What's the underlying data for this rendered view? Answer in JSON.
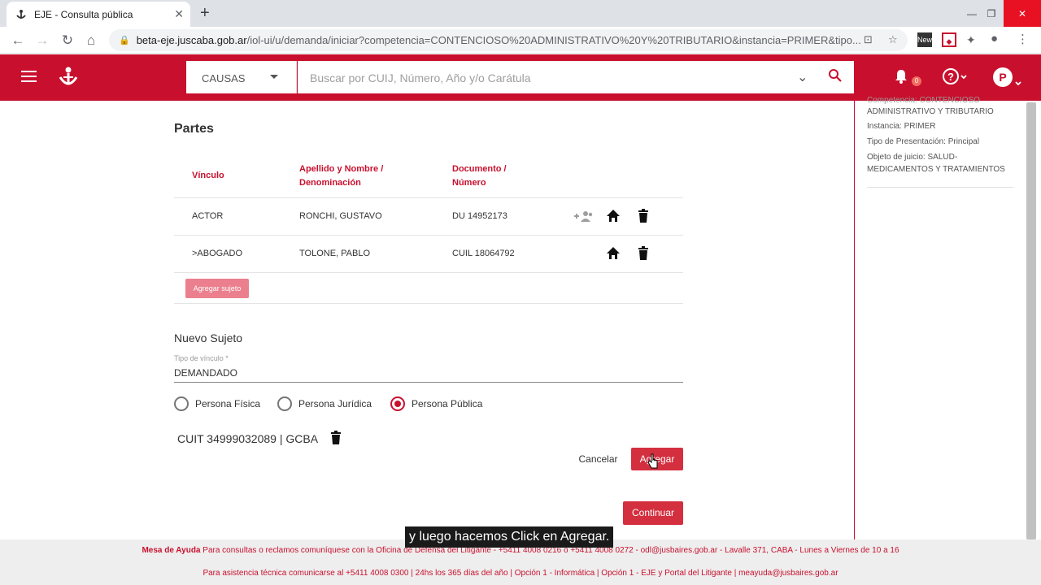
{
  "browser": {
    "tab_title": "EJE - Consulta pública",
    "url_host": "beta-eje.juscaba.gob.ar",
    "url_path": "/iol-ui/u/demanda/iniciar?competencia=CONTENCIOSO%20ADMINISTRATIVO%20Y%20TRIBUTARIO&instancia=PRIMER&tipo..."
  },
  "header": {
    "search_category": "CAUSAS",
    "search_placeholder": "Buscar por CUIJ, Número, Año y/o Carátula",
    "notification_count": "0",
    "avatar_initial": "P"
  },
  "partes": {
    "title": "Partes",
    "columns": {
      "vinculo": "Vínculo",
      "nombre_1": "Apellido y Nombre /",
      "nombre_2": "Denominación",
      "documento_1": "Documento /",
      "documento_2": "Número"
    },
    "rows": [
      {
        "vinculo": "ACTOR",
        "nombre": "RONCHI, GUSTAVO",
        "documento": "DU 14952173"
      },
      {
        "vinculo": ">ABOGADO",
        "nombre": "TOLONE, PABLO",
        "documento": "CUIL 18064792"
      }
    ],
    "add_button": "Agregar sujeto"
  },
  "nuevo_sujeto": {
    "title": "Nuevo Sujeto",
    "tipo_label": "Tipo de vínculo *",
    "tipo_value": "DEMANDADO",
    "radios": [
      {
        "label": "Persona Física",
        "selected": false
      },
      {
        "label": "Persona Jurídica",
        "selected": false
      },
      {
        "label": "Persona Pública",
        "selected": true
      }
    ],
    "cuit_text": "CUIT 34999032089 | GCBA",
    "cancel_label": "Cancelar",
    "add_label": "Agregar",
    "continue_label": "Continuar"
  },
  "summary": {
    "competencia_partial": "Competencia: CONTENCIOSO",
    "competencia_cont": "ADMINISTRATIVO Y TRIBUTARIO",
    "instancia": "Instancia: PRIMER",
    "tipo_presentacion": "Tipo de Presentación: Principal",
    "objeto_1": "Objeto de juicio: SALUD-",
    "objeto_2": "MEDICAMENTOS Y TRATAMIENTOS"
  },
  "footer": {
    "help_title": "Mesa de Ayuda",
    "line1": "Para consultas o reclamos comuníquese con la Oficina de Defensa del Litigante - +5411 4008 0216 ó +5411 4008 0272 - odl@jusbaires.gob.ar - Lavalle 371, CABA - Lunes a Viernes de 10 a 16",
    "line2": "Para asistencia técnica comunicarse al +5411 4008 0300 | 24hs los 365 días del año | Opción 1 - Informática | Opción 1 - EJE y Portal del Litigante | meayuda@jusbaires.gob.ar"
  },
  "caption": "y luego hacemos Click en Agregar.",
  "colors": {
    "brand": "#c8102e",
    "button_red": "#d32f3f",
    "button_disabled": "#eb7f8e"
  }
}
